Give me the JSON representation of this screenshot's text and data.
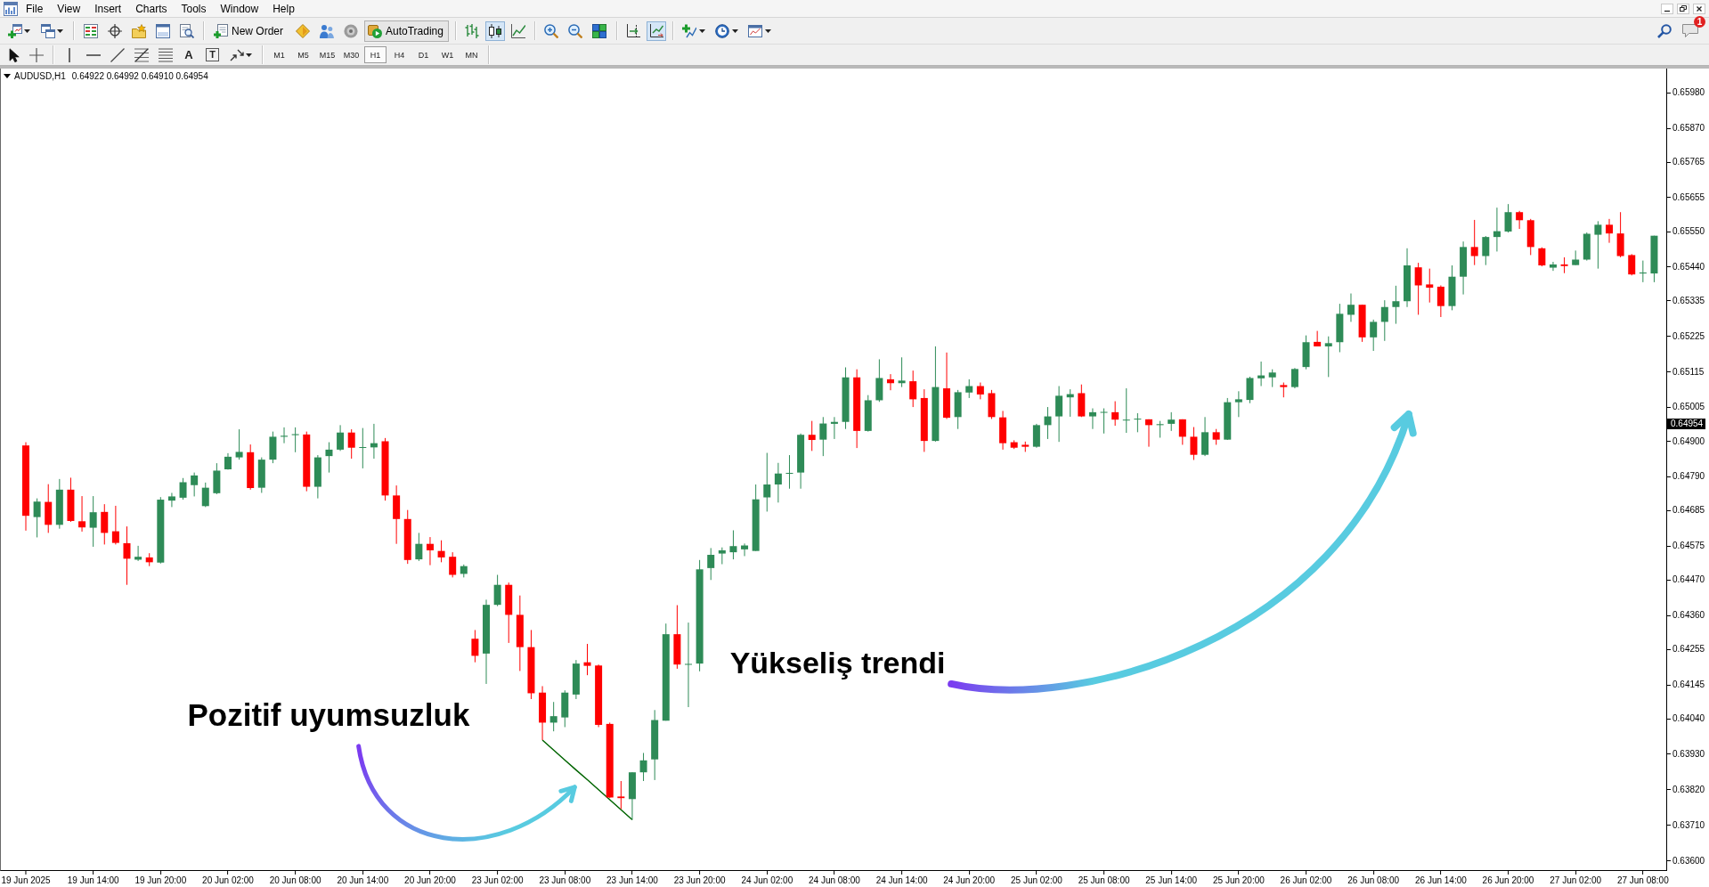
{
  "menu": [
    "File",
    "View",
    "Insert",
    "Charts",
    "Tools",
    "Window",
    "Help"
  ],
  "toolbar": {
    "new_order": "New Order",
    "autotrading": {
      "label": "AutoTrading",
      "on": true
    },
    "chart_modes": [
      {
        "kind": "bars",
        "selected": false
      },
      {
        "kind": "candles",
        "selected": true
      },
      {
        "kind": "line",
        "selected": false
      }
    ],
    "chart_shift": {
      "on": false
    },
    "auto_scroll": {
      "on": true
    }
  },
  "drawing_toolbar": {
    "text_tool": "A",
    "text_label_tool": "T"
  },
  "timeframes": [
    {
      "label": "M1",
      "selected": false
    },
    {
      "label": "M5",
      "selected": false
    },
    {
      "label": "M15",
      "selected": false
    },
    {
      "label": "M30",
      "selected": false
    },
    {
      "label": "H1",
      "selected": true
    },
    {
      "label": "H4",
      "selected": false
    },
    {
      "label": "D1",
      "selected": false
    },
    {
      "label": "W1",
      "selected": false
    },
    {
      "label": "MN",
      "selected": false
    }
  ],
  "notifications": {
    "count": "1"
  },
  "chart": {
    "symbol": "AUDUSD,H1",
    "quote": "0.64922 0.64992 0.64910 0.64954",
    "chart_data": {
      "type": "candlestick",
      "categories": [
        "19 Jun 2025",
        null,
        null,
        null,
        null,
        null,
        "19 Jun 14:00",
        null,
        null,
        null,
        null,
        null,
        "19 Jun 20:00",
        null,
        null,
        null,
        null,
        null,
        "20 Jun 02:00",
        null,
        null,
        null,
        null,
        null,
        "20 Jun 08:00",
        null,
        null,
        null,
        null,
        null,
        "20 Jun 14:00",
        null,
        null,
        null,
        null,
        null,
        "20 Jun 20:00",
        null,
        null,
        null,
        null,
        null,
        "23 Jun 02:00",
        null,
        null,
        null,
        null,
        null,
        "23 Jun 08:00",
        null,
        null,
        null,
        null,
        null,
        "23 Jun 14:00",
        null,
        null,
        null,
        null,
        null,
        "23 Jun 20:00",
        null,
        null,
        null,
        null,
        null,
        "24 Jun 02:00",
        null,
        null,
        null,
        null,
        null,
        "24 Jun 08:00",
        null,
        null,
        null,
        null,
        null,
        "24 Jun 14:00",
        null,
        null,
        null,
        null,
        null,
        "24 Jun 20:00",
        null,
        null,
        null,
        null,
        null,
        "25 Jun 02:00",
        null,
        null,
        null,
        null,
        null,
        "25 Jun 08:00",
        null,
        null,
        null,
        null,
        null,
        "25 Jun 14:00",
        null,
        null,
        null,
        null,
        null,
        "25 Jun 20:00",
        null,
        null,
        null,
        null,
        null,
        "26 Jun 02:00",
        null,
        null,
        null,
        null,
        null,
        "26 Jun 08:00",
        null,
        null,
        null,
        null,
        null,
        "26 Jun 14:00",
        null,
        null,
        null,
        null,
        null,
        "26 Jun 20:00",
        null,
        null,
        null,
        null,
        null,
        "27 Jun 02:00",
        null,
        null,
        null,
        null,
        null,
        "27 Jun 08:00",
        null
      ],
      "ohlc": [
        [
          0.64887,
          0.64897,
          0.64623,
          0.64669
        ],
        [
          0.64665,
          0.64723,
          0.64602,
          0.64713
        ],
        [
          0.64712,
          0.64767,
          0.64616,
          0.64641
        ],
        [
          0.64641,
          0.64783,
          0.64629,
          0.6475
        ],
        [
          0.6475,
          0.64787,
          0.6465,
          0.64653
        ],
        [
          0.64652,
          0.6473,
          0.6462,
          0.64633
        ],
        [
          0.64632,
          0.6473,
          0.64573,
          0.6468
        ],
        [
          0.64681,
          0.64705,
          0.6458,
          0.64616
        ],
        [
          0.64621,
          0.647,
          0.6458,
          0.64585
        ],
        [
          0.64584,
          0.64636,
          0.64455,
          0.64536
        ],
        [
          0.64533,
          0.64576,
          0.64529,
          0.64542
        ],
        [
          0.6454,
          0.64553,
          0.64513,
          0.64525
        ],
        [
          0.64524,
          0.64727,
          0.64521,
          0.64719
        ],
        [
          0.64716,
          0.6474,
          0.64696,
          0.64729
        ],
        [
          0.64725,
          0.64786,
          0.64719,
          0.64773
        ],
        [
          0.64764,
          0.64803,
          0.64729,
          0.64794
        ],
        [
          0.64699,
          0.64772,
          0.64696,
          0.64756
        ],
        [
          0.64739,
          0.64832,
          0.64736,
          0.64809
        ],
        [
          0.64813,
          0.64863,
          0.64812,
          0.64852
        ],
        [
          0.6485,
          0.64937,
          0.64843,
          0.64867
        ],
        [
          0.64866,
          0.6489,
          0.6475,
          0.64755
        ],
        [
          0.64756,
          0.6485,
          0.6474,
          0.64843
        ],
        [
          0.64843,
          0.6493,
          0.64832,
          0.64914
        ],
        [
          0.64914,
          0.64943,
          0.64894,
          0.64917
        ],
        [
          0.64919,
          0.64943,
          0.64866,
          0.64922
        ],
        [
          0.64921,
          0.6493,
          0.64745,
          0.64759
        ],
        [
          0.64759,
          0.64857,
          0.64723,
          0.6485
        ],
        [
          0.64854,
          0.64897,
          0.64803,
          0.64874
        ],
        [
          0.64874,
          0.6495,
          0.6487,
          0.64927
        ],
        [
          0.64927,
          0.64937,
          0.64846,
          0.6488
        ],
        [
          0.6488,
          0.64941,
          0.64816,
          0.64882
        ],
        [
          0.64881,
          0.64954,
          0.64846,
          0.64894
        ],
        [
          0.649,
          0.6491,
          0.64716,
          0.64732
        ],
        [
          0.64732,
          0.64763,
          0.64582,
          0.64659
        ],
        [
          0.64659,
          0.64687,
          0.6452,
          0.64532
        ],
        [
          0.64534,
          0.64616,
          0.64529,
          0.64582
        ],
        [
          0.64582,
          0.64603,
          0.64516,
          0.64562
        ],
        [
          0.6456,
          0.64593,
          0.64525,
          0.6454
        ],
        [
          0.64542,
          0.64556,
          0.64478,
          0.64486
        ],
        [
          0.64489,
          0.64518,
          0.64478,
          0.64513
        ],
        [
          0.64288,
          0.64315,
          0.64215,
          0.64235
        ],
        [
          0.64242,
          0.64409,
          0.64148,
          0.64393
        ],
        [
          0.64393,
          0.64486,
          0.64389,
          0.64455
        ],
        [
          0.64455,
          0.64462,
          0.64275,
          0.64362
        ],
        [
          0.64362,
          0.64422,
          0.64188,
          0.64262
        ],
        [
          0.64262,
          0.64315,
          0.64101,
          0.64119
        ],
        [
          0.64121,
          0.64141,
          0.63974,
          0.64028
        ],
        [
          0.64028,
          0.64092,
          0.64001,
          0.64048
        ],
        [
          0.64044,
          0.64128,
          0.64014,
          0.64121
        ],
        [
          0.64115,
          0.64222,
          0.64101,
          0.64211
        ],
        [
          0.64215,
          0.64272,
          0.64175,
          0.64204
        ],
        [
          0.64205,
          0.64208,
          0.64014,
          0.64021
        ],
        [
          0.64024,
          0.64028,
          0.63794,
          0.63796
        ],
        [
          0.63799,
          0.63847,
          0.6376,
          0.63794
        ],
        [
          0.63791,
          0.63874,
          0.63727,
          0.63874
        ],
        [
          0.63874,
          0.63934,
          0.63847,
          0.63911
        ],
        [
          0.63914,
          0.64067,
          0.6385,
          0.64036
        ],
        [
          0.64034,
          0.64335,
          0.64034,
          0.64302
        ],
        [
          0.64302,
          0.64392,
          0.64195,
          0.64208
        ],
        [
          0.64208,
          0.64338,
          0.64076,
          0.6421
        ],
        [
          0.64211,
          0.64532,
          0.64187,
          0.64503
        ],
        [
          0.64507,
          0.64569,
          0.6447,
          0.64548
        ],
        [
          0.64552,
          0.64571,
          0.64519,
          0.64562
        ],
        [
          0.64556,
          0.64624,
          0.64534,
          0.64575
        ],
        [
          0.64565,
          0.64583,
          0.64544,
          0.64577
        ],
        [
          0.6456,
          0.64766,
          0.6456,
          0.6472
        ],
        [
          0.64726,
          0.64864,
          0.64682,
          0.64766
        ],
        [
          0.64766,
          0.64833,
          0.6471,
          0.648
        ],
        [
          0.648,
          0.64857,
          0.64753,
          0.64802
        ],
        [
          0.64803,
          0.64924,
          0.64753,
          0.6492
        ],
        [
          0.6492,
          0.64963,
          0.6487,
          0.64904
        ],
        [
          0.64905,
          0.64975,
          0.64854,
          0.64955
        ],
        [
          0.64954,
          0.64975,
          0.64907,
          0.6496
        ],
        [
          0.6496,
          0.65129,
          0.64938,
          0.65098
        ],
        [
          0.65098,
          0.65123,
          0.64879,
          0.64932
        ],
        [
          0.64932,
          0.65043,
          0.6493,
          0.65027
        ],
        [
          0.65027,
          0.65154,
          0.65022,
          0.65096
        ],
        [
          0.65092,
          0.65108,
          0.65058,
          0.6508
        ],
        [
          0.6508,
          0.6516,
          0.65068,
          0.65088
        ],
        [
          0.65086,
          0.65119,
          0.65006,
          0.6503
        ],
        [
          0.65034,
          0.65061,
          0.64867,
          0.64901
        ],
        [
          0.64901,
          0.65194,
          0.64899,
          0.65068
        ],
        [
          0.65064,
          0.65175,
          0.64969,
          0.64973
        ],
        [
          0.64975,
          0.65059,
          0.64938,
          0.65052
        ],
        [
          0.65051,
          0.65092,
          0.65034,
          0.65071
        ],
        [
          0.65071,
          0.65082,
          0.6503,
          0.65045
        ],
        [
          0.65049,
          0.65059,
          0.64969,
          0.64975
        ],
        [
          0.64974,
          0.64994,
          0.64874,
          0.64894
        ],
        [
          0.64897,
          0.64903,
          0.64876,
          0.6488
        ],
        [
          0.64889,
          0.64899,
          0.64867,
          0.64883
        ],
        [
          0.64883,
          0.64954,
          0.6488,
          0.6495
        ],
        [
          0.6495,
          0.65006,
          0.64907,
          0.64977
        ],
        [
          0.64977,
          0.65071,
          0.64898,
          0.65041
        ],
        [
          0.65036,
          0.65061,
          0.64976,
          0.65046
        ],
        [
          0.65049,
          0.65076,
          0.64975,
          0.64977
        ],
        [
          0.64977,
          0.65002,
          0.64938,
          0.6499
        ],
        [
          0.64989,
          0.65002,
          0.64924,
          0.64991
        ],
        [
          0.6499,
          0.65024,
          0.64948,
          0.64967
        ],
        [
          0.64965,
          0.65064,
          0.64926,
          0.64967
        ],
        [
          0.64968,
          0.64987,
          0.64928,
          0.6497
        ],
        [
          0.64968,
          0.64968,
          0.64883,
          0.6495
        ],
        [
          0.6495,
          0.64963,
          0.64911,
          0.64953
        ],
        [
          0.64954,
          0.6499,
          0.64932,
          0.64967
        ],
        [
          0.64968,
          0.64968,
          0.64889,
          0.64914
        ],
        [
          0.64914,
          0.64944,
          0.64842,
          0.64858
        ],
        [
          0.64858,
          0.64975,
          0.64854,
          0.64928
        ],
        [
          0.64928,
          0.64938,
          0.64889,
          0.64905
        ],
        [
          0.64905,
          0.65034,
          0.64904,
          0.65021
        ],
        [
          0.65021,
          0.65055,
          0.64975,
          0.6503
        ],
        [
          0.65028,
          0.651,
          0.65018,
          0.65096
        ],
        [
          0.65095,
          0.65147,
          0.65071,
          0.65104
        ],
        [
          0.65098,
          0.65123,
          0.65068,
          0.65113
        ],
        [
          0.65074,
          0.65082,
          0.65036,
          0.65068
        ],
        [
          0.65068,
          0.65127,
          0.65064,
          0.65124
        ],
        [
          0.6513,
          0.65228,
          0.65123,
          0.65207
        ],
        [
          0.65208,
          0.65242,
          0.65194,
          0.65194
        ],
        [
          0.65194,
          0.65225,
          0.65099,
          0.65204
        ],
        [
          0.65207,
          0.65326,
          0.65176,
          0.65295
        ],
        [
          0.65292,
          0.65358,
          0.6527,
          0.65323
        ],
        [
          0.65323,
          0.65323,
          0.65208,
          0.65222
        ],
        [
          0.65222,
          0.65277,
          0.6518,
          0.6527
        ],
        [
          0.6527,
          0.65337,
          0.65211,
          0.65316
        ],
        [
          0.65316,
          0.65382,
          0.65264,
          0.65334
        ],
        [
          0.65334,
          0.65498,
          0.65316,
          0.65445
        ],
        [
          0.65439,
          0.65453,
          0.65292,
          0.65383
        ],
        [
          0.65386,
          0.65435,
          0.6533,
          0.65376
        ],
        [
          0.65379,
          0.65383,
          0.65285,
          0.65319
        ],
        [
          0.65319,
          0.65445,
          0.65306,
          0.6541
        ],
        [
          0.6541,
          0.65519,
          0.65355,
          0.65502
        ],
        [
          0.65502,
          0.65586,
          0.65446,
          0.65474
        ],
        [
          0.65474,
          0.65536,
          0.65446,
          0.65533
        ],
        [
          0.65533,
          0.65624,
          0.65488,
          0.65551
        ],
        [
          0.6555,
          0.65635,
          0.65547,
          0.6561
        ],
        [
          0.6561,
          0.65614,
          0.65558,
          0.65585
        ],
        [
          0.65585,
          0.65589,
          0.65477,
          0.65502
        ],
        [
          0.65498,
          0.65501,
          0.65442,
          0.65445
        ],
        [
          0.65438,
          0.65456,
          0.65428,
          0.65448
        ],
        [
          0.65448,
          0.6547,
          0.65421,
          0.65443
        ],
        [
          0.65446,
          0.65491,
          0.65446,
          0.65463
        ],
        [
          0.65463,
          0.65547,
          0.6546,
          0.65543
        ],
        [
          0.6554,
          0.65582,
          0.65435,
          0.65571
        ],
        [
          0.65571,
          0.65589,
          0.65515,
          0.65544
        ],
        [
          0.65544,
          0.6561,
          0.6547,
          0.65474
        ],
        [
          0.65477,
          0.6548,
          0.65414,
          0.65417
        ],
        [
          0.6542,
          0.6546,
          0.65393,
          0.65423
        ],
        [
          0.6542,
          0.65537,
          0.65393,
          0.65537
        ]
      ],
      "series": [
        {
          "type": "line",
          "color": "#006400",
          "values": [
            null,
            null,
            null,
            null,
            null,
            null,
            null,
            null,
            null,
            null,
            null,
            null,
            null,
            null,
            null,
            null,
            null,
            null,
            null,
            null,
            null,
            null,
            null,
            null,
            null,
            null,
            null,
            null,
            null,
            null,
            null,
            null,
            null,
            null,
            null,
            null,
            null,
            null,
            null,
            null,
            null,
            null,
            null,
            null,
            null,
            null,
            0.63974,
            0.63943,
            0.63912,
            0.63881,
            0.63851,
            0.6382,
            0.63789,
            0.63758,
            0.63727,
            null,
            null,
            null,
            null,
            null,
            null,
            null,
            null,
            null,
            null,
            null,
            null,
            null,
            null,
            null,
            null,
            null,
            null,
            null,
            null,
            null,
            null,
            null,
            null,
            null,
            null,
            null,
            null,
            null,
            null,
            null,
            null,
            null,
            null,
            null,
            null,
            null,
            null,
            null,
            null,
            null,
            null,
            null,
            null,
            null,
            null,
            null,
            null,
            null,
            null,
            null,
            null,
            null,
            null,
            null,
            null,
            null,
            null,
            null,
            null,
            null,
            null,
            null,
            null,
            null,
            null,
            null,
            null,
            null,
            null,
            null,
            null,
            null,
            null,
            null,
            null,
            null,
            null,
            null,
            null,
            null,
            null,
            null,
            null,
            null,
            null,
            null,
            null,
            null,
            null,
            null
          ]
        }
      ],
      "ylim": [
        0.63571,
        0.66055
      ],
      "yticks": [
        {
          "value": 0.6598,
          "label": "0.65980"
        },
        {
          "value": 0.6587,
          "label": "0.65870"
        },
        {
          "value": 0.65765,
          "label": "0.65765"
        },
        {
          "value": 0.65655,
          "label": "0.65655"
        },
        {
          "value": 0.6555,
          "label": "0.65550"
        },
        {
          "value": 0.6544,
          "label": "0.65440"
        },
        {
          "value": 0.65335,
          "label": "0.65335"
        },
        {
          "value": 0.65225,
          "label": "0.65225"
        },
        {
          "value": 0.65115,
          "label": "0.65115"
        },
        {
          "value": 0.65005,
          "label": "0.65005"
        },
        {
          "value": 0.64954,
          "label": "0.64954"
        },
        {
          "value": 0.649,
          "label": "0.64900"
        },
        {
          "value": 0.6479,
          "label": "0.64790"
        },
        {
          "value": 0.64685,
          "label": "0.64685"
        },
        {
          "value": 0.64575,
          "label": "0.64575"
        },
        {
          "value": 0.6447,
          "label": "0.64470"
        },
        {
          "value": 0.6436,
          "label": "0.64360"
        },
        {
          "value": 0.64255,
          "label": "0.64255"
        },
        {
          "value": 0.64145,
          "label": "0.64145"
        },
        {
          "value": 0.6404,
          "label": "0.64040"
        },
        {
          "value": 0.6393,
          "label": "0.63930"
        },
        {
          "value": 0.6382,
          "label": "0.63820"
        },
        {
          "value": 0.6371,
          "label": "0.63710"
        },
        {
          "value": 0.636,
          "label": "0.63600"
        }
      ],
      "annotations": [
        "Pozitif uyumsuzluk",
        "Yükseliş trendi"
      ]
    }
  }
}
